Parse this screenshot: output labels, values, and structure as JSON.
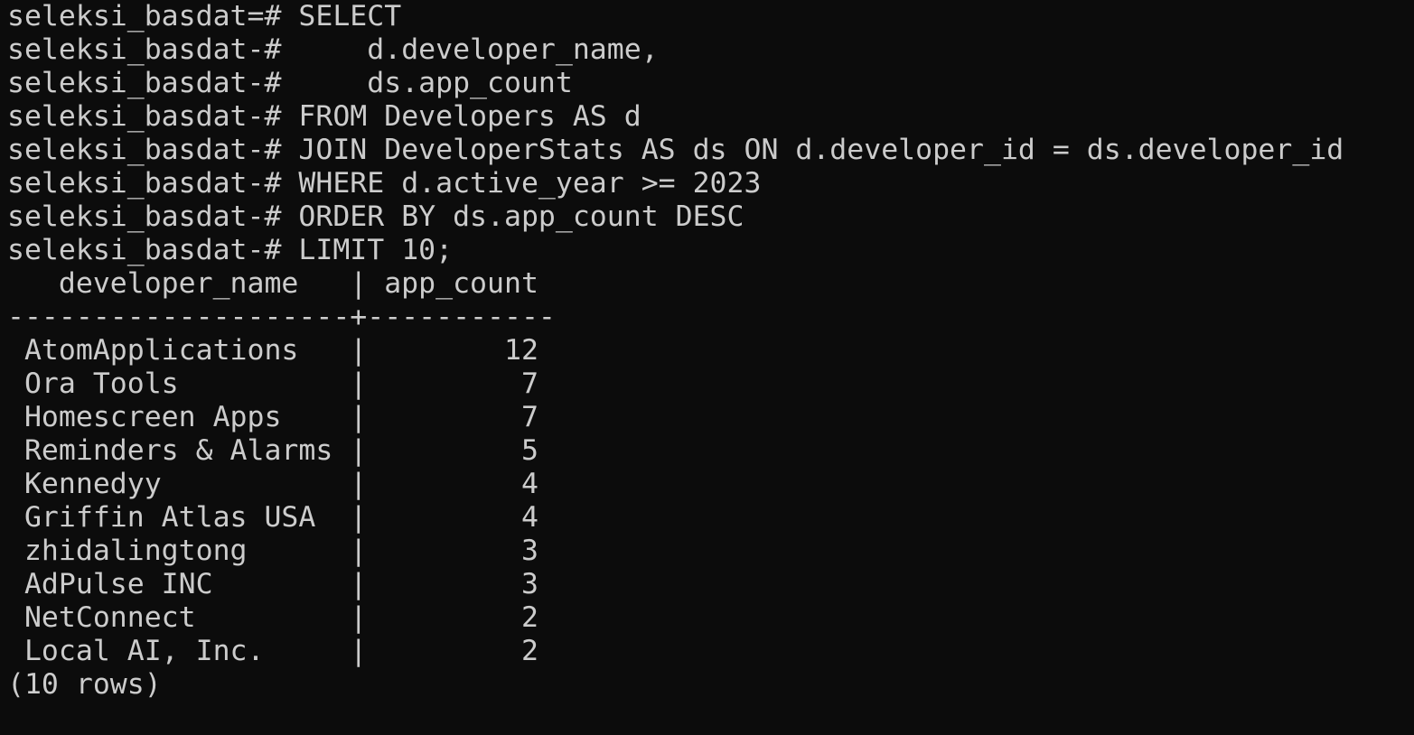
{
  "terminal": {
    "background": "#0c0c0c",
    "foreground": "#cccccc",
    "prompt_first": "seleksi_basdat=# ",
    "prompt_cont": "seleksi_basdat-# ",
    "query_lines": [
      "SELECT",
      "    d.developer_name,",
      "    ds.app_count",
      "FROM Developers AS d",
      "JOIN DeveloperStats AS ds ON d.developer_id = ds.developer_id",
      "WHERE d.active_year >= 2023",
      "ORDER BY ds.app_count DESC",
      "LIMIT 10;"
    ],
    "result": {
      "header": "   developer_name   | app_count",
      "separator": "--------------------+-----------",
      "rows": [
        " AtomApplications   |        12",
        " Ora Tools          |         7",
        " Homescreen Apps    |         7",
        " Reminders & Alarms |         5",
        " Kennedyy           |         4",
        " Griffin Atlas USA  |         4",
        " zhidalingtong      |         3",
        " AdPulse INC        |         3",
        " NetConnect         |         2",
        " Local AI, Inc.     |         2"
      ],
      "footer": "(10 rows)"
    }
  }
}
